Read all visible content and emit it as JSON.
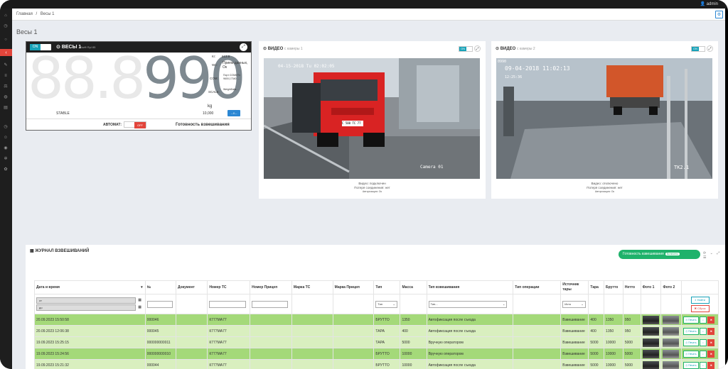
{
  "topbar": {
    "user": "admin"
  },
  "breadcrumb": {
    "home": "Главная",
    "separator": "/",
    "current": "Весы 1"
  },
  "page": {
    "title": "Весы 1"
  },
  "scale": {
    "toggle": "ON",
    "title": "ВЕСЫ 1",
    "subtitle": "Swift Rpl 85",
    "digits_dim": "88.8",
    "digits_lit": "990",
    "info_lines": [
      {
        "label": "Кг:",
        "value": "613.9"
      },
      {
        "label": "Wc:",
        "value": "Прием данных, Ок"
      },
      {
        "label": "COM:",
        "value": "Порт COM6/Tx 9600,17340 …"
      },
      {
        "label": "SCALE:",
        "value": "WeightData…"
      }
    ],
    "unit": "kg",
    "weight_value": "10,000",
    "zero_button": "→0←",
    "status": "STABLE",
    "auto_label": "АВТОМАТ:",
    "auto_toggle": "OFF",
    "ready": "Готовность взвешивания"
  },
  "cam1": {
    "title": "ВИДЕО",
    "sub": "с камеры 1",
    "toggle": "ON",
    "overlay_time": "04-15-2018 Tu 02:02:05",
    "overlay_name": "Camera 01",
    "plate": "С 500 ТС 77",
    "cap1": "Видео: подключен",
    "cap2": "Потеря соединения: нет",
    "cap3": "Авторизация: Ок"
  },
  "cam2": {
    "title": "ВИДЕО",
    "sub": "с камеры 2",
    "toggle": "ON",
    "overlay_top": "0990",
    "overlay_time": "09-04-2018 11:02:13",
    "overlay_time2": "12:25:36",
    "overlay_name": "TK2.1",
    "cap1": "Видео: отключено",
    "cap2": "Потеря соединения: нет",
    "cap3": "Авторизация: Ок"
  },
  "journal": {
    "title": "ЖУРНАЛ ВЗВЕШИВАНИЙ",
    "ready_btn": "Готовность взвешивания",
    "ready_badge": "Включено",
    "tools": "⟳ ⌄ ⤢ ☰",
    "columns": [
      "Дата и время",
      "№",
      "Документ",
      "Номер ТС",
      "Номер Прицеп",
      "Марка ТС",
      "Марка Прицеп",
      "Тип",
      "Масса",
      "Тип взвешивания",
      "Тип операции",
      "Источник тары",
      "Тара",
      "Брутто",
      "Нетто",
      "Фото 1",
      "Фото 2",
      ""
    ],
    "filters": {
      "date_from": "от",
      "date_to": "до",
      "type_select": "Тип",
      "weigh_select": "Тип...",
      "source_select": "Исто",
      "find": "Найти",
      "reset": "Сброс"
    },
    "print_label": "Печать",
    "rows": [
      {
        "dt": "20.09.2023 15:50:58",
        "no": "000046",
        "doc": "",
        "ts": "К777МА77",
        "trailer": "",
        "brand": "",
        "tbrand": "",
        "type": "БРУТТО",
        "mass": "1350",
        "wtype": "Автофиксация после съезда",
        "op": "",
        "src": "Взвешивание",
        "tara": "400",
        "brutto": "1350",
        "netto": "950"
      },
      {
        "dt": "20.09.2023 12:06:38",
        "no": "000045",
        "doc": "",
        "ts": "К777МА77",
        "trailer": "",
        "brand": "",
        "tbrand": "",
        "type": "ТАРА",
        "mass": "400",
        "wtype": "Автофиксация после съезда",
        "op": "",
        "src": "Взвешивание",
        "tara": "400",
        "brutto": "1350",
        "netto": "950"
      },
      {
        "dt": "19.09.2023 15:25:15",
        "no": "000000000011",
        "doc": "",
        "ts": "К777МА77",
        "trailer": "",
        "brand": "",
        "tbrand": "",
        "type": "ТАРА",
        "mass": "5000",
        "wtype": "Вручную оператором",
        "op": "",
        "src": "Взвешивание",
        "tara": "5000",
        "brutto": "10000",
        "netto": "5000"
      },
      {
        "dt": "19.09.2023 15:24:56",
        "no": "000000000010",
        "doc": "",
        "ts": "К777МА77",
        "trailer": "",
        "brand": "",
        "tbrand": "",
        "type": "БРУТТО",
        "mass": "10000",
        "wtype": "Вручную оператором",
        "op": "",
        "src": "Взвешивание",
        "tara": "5000",
        "brutto": "10000",
        "netto": "5000"
      },
      {
        "dt": "19.09.2023 15:21:32",
        "no": "000044",
        "doc": "",
        "ts": "К777МА77",
        "trailer": "",
        "brand": "",
        "tbrand": "",
        "type": "БРУТТО",
        "mass": "10000",
        "wtype": "Автофиксация после съезда",
        "op": "",
        "src": "Взвешивание",
        "tara": "5000",
        "brutto": "10000",
        "netto": "5000"
      }
    ]
  }
}
